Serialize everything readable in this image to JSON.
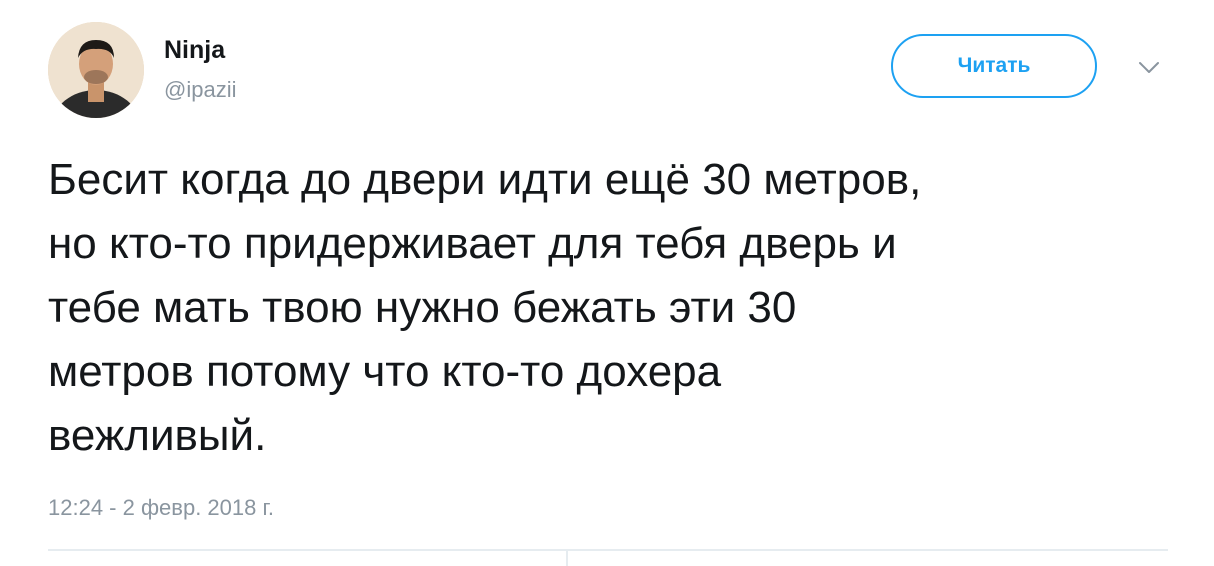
{
  "author": {
    "display_name": "Ninja",
    "handle": "@ipazii"
  },
  "follow_button": {
    "label": "Читать"
  },
  "tweet": {
    "lines": [
      "Бесит когда до двери идти ещё 30 метров,",
      "но кто-то придерживает для тебя дверь и",
      "тебе мать твою нужно бежать эти 30",
      "метров потому что кто-то дохера",
      "вежливый."
    ],
    "timestamp": "12:24 - 2 февр. 2018 г."
  },
  "icons": {
    "avatar": "user-avatar-photo",
    "menu": "chevron-down-icon"
  },
  "colors": {
    "accent": "#1da1f2",
    "text": "#14171a",
    "secondary_text": "#8a959f",
    "divider": "#e6ecf0"
  }
}
